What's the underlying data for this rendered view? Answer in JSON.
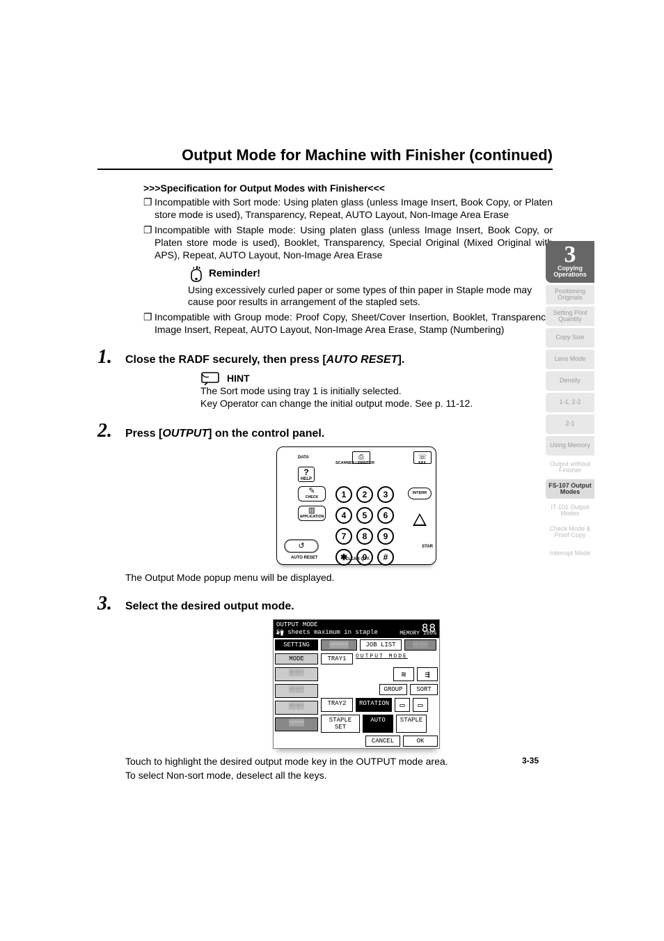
{
  "header": {
    "title": "Output Mode for Machine with Finisher (continued)"
  },
  "spec": {
    "heading": ">>>Specification for Output Modes with Finisher<<<",
    "bullet_glyph": "❐",
    "items": [
      "Incompatible with Sort mode: Using platen glass (unless Image Insert, Book Copy, or Platen store mode is used), Transparency, Repeat, AUTO Layout, Non-Image Area Erase",
      "Incompatible with Staple mode: Using platen glass (unless Image Insert, Book Copy, or Platen store mode is used), Booklet, Transparency, Special Original (Mixed Original with APS), Repeat, AUTO Layout, Non-Image Area Erase"
    ],
    "reminder_label": "Reminder!",
    "reminder_body": "Using excessively curled paper or some types of thin paper in Staple mode may cause poor results in arrangement of the stapled sets.",
    "item3": "Incompatible with Group mode: Proof Copy, Sheet/Cover Insertion, Booklet, Transparency, Image Insert, Repeat, AUTO Layout, Non-Image Area Erase, Stamp (Numbering)"
  },
  "steps": {
    "s1": {
      "num": "1.",
      "title_a": "Close the RADF securely, then press [",
      "title_em": "AUTO RESET",
      "title_b": "].",
      "hint_label": "HINT",
      "hint_body1": "The Sort mode using tray 1 is initially selected.",
      "hint_body2": "Key Operator can change the initial output mode. See p. 11-12."
    },
    "s2": {
      "num": "2.",
      "title_a": "Press [",
      "title_em": "OUTPUT",
      "title_b": "] on the control panel.",
      "after": "The Output Mode popup menu will be displayed."
    },
    "s3": {
      "num": "3.",
      "title": "Select the desired output mode.",
      "after1": "Touch to highlight the desired output mode key in the OUTPUT mode area.",
      "after2": "To select Non-sort mode, deselect all the keys."
    }
  },
  "panel": {
    "data": "DATA",
    "scanner_printer": "SCANNER / PRINTER",
    "fax": "FAX",
    "help": "HELP",
    "check": "CHECK",
    "application": "APPLICATION",
    "interr": "INTERR",
    "star_label": "STAR",
    "clear_qty": "CLEAR QTY.",
    "auto_reset": "AUTO RESET",
    "keys": [
      "1",
      "2",
      "3",
      "4",
      "5",
      "6",
      "7",
      "8",
      "9",
      "✱",
      "0",
      "#"
    ]
  },
  "screen": {
    "title": "OUTPUT MODE",
    "subtitle": "50 sheets maximum in staple",
    "memory": "MEMORY 100%",
    "setting": "SETTING",
    "mode": "MODE",
    "joblist": "JOB LIST",
    "outmode_label": "OUTPUT MODE",
    "tray1": "TRAY1",
    "tray2": "TRAY2",
    "group": "GROUP",
    "sort": "SORT",
    "rotation": "ROTATION",
    "auto": "AUTO",
    "staple": "STAPLE",
    "stapleset": "STAPLE SET",
    "cancel": "CANCEL",
    "ok": "OK"
  },
  "sidebar": {
    "lead_num": "3",
    "lead_1": "Copying",
    "lead_2": "Operations",
    "tabs": [
      "Positioning Originals",
      "Setting Print Quantity",
      "Copy Size",
      "Lens Mode",
      "Density",
      "1-1, 2-2",
      "2-1",
      "Using Memory",
      "Output without Finisher",
      "FS-107 Output Modes",
      "IT-101 Output Modes",
      "Check Mode & Proof Copy",
      "Interrupt Mode"
    ],
    "active_index": 9
  },
  "footer": {
    "pagenum": "3-35"
  }
}
